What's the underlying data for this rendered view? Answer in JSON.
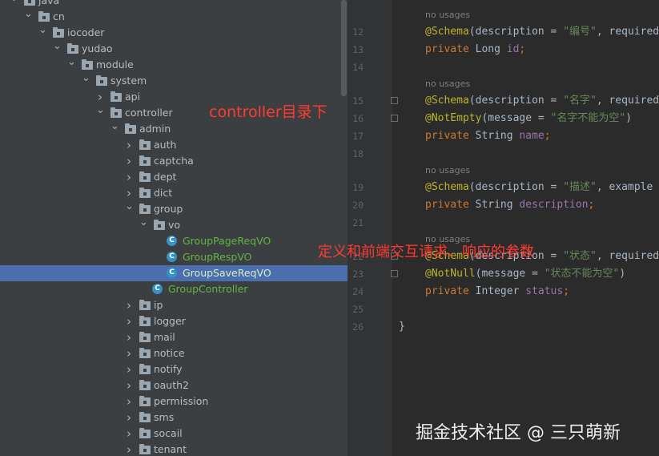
{
  "tree": {
    "rows": [
      {
        "label": "java",
        "type": "folder",
        "expanded": true,
        "depth": 0
      },
      {
        "label": "cn",
        "type": "folder",
        "expanded": true,
        "depth": 1
      },
      {
        "label": "iocoder",
        "type": "folder",
        "expanded": true,
        "depth": 2
      },
      {
        "label": "yudao",
        "type": "folder",
        "expanded": true,
        "depth": 3
      },
      {
        "label": "module",
        "type": "folder",
        "expanded": true,
        "depth": 4
      },
      {
        "label": "system",
        "type": "folder",
        "expanded": true,
        "depth": 5
      },
      {
        "label": "api",
        "type": "folder",
        "expanded": false,
        "depth": 6
      },
      {
        "label": "controller",
        "type": "folder",
        "expanded": true,
        "depth": 6
      },
      {
        "label": "admin",
        "type": "folder",
        "expanded": true,
        "depth": 7
      },
      {
        "label": "auth",
        "type": "folder",
        "expanded": false,
        "depth": 8
      },
      {
        "label": "captcha",
        "type": "folder",
        "expanded": false,
        "depth": 8
      },
      {
        "label": "dept",
        "type": "folder",
        "expanded": false,
        "depth": 8
      },
      {
        "label": "dict",
        "type": "folder",
        "expanded": false,
        "depth": 8
      },
      {
        "label": "group",
        "type": "folder",
        "expanded": true,
        "depth": 8
      },
      {
        "label": "vo",
        "type": "folder",
        "expanded": true,
        "depth": 9
      },
      {
        "label": "GroupPageReqVO",
        "type": "class",
        "depth": 10
      },
      {
        "label": "GroupRespVO",
        "type": "class",
        "depth": 10
      },
      {
        "label": "GroupSaveReqVO",
        "type": "class",
        "depth": 10,
        "selected": true
      },
      {
        "label": "GroupController",
        "type": "class",
        "depth": 9
      },
      {
        "label": "ip",
        "type": "folder",
        "expanded": false,
        "depth": 8
      },
      {
        "label": "logger",
        "type": "folder",
        "expanded": false,
        "depth": 8
      },
      {
        "label": "mail",
        "type": "folder",
        "expanded": false,
        "depth": 8
      },
      {
        "label": "notice",
        "type": "folder",
        "expanded": false,
        "depth": 8
      },
      {
        "label": "notify",
        "type": "folder",
        "expanded": false,
        "depth": 8
      },
      {
        "label": "oauth2",
        "type": "folder",
        "expanded": false,
        "depth": 8
      },
      {
        "label": "permission",
        "type": "folder",
        "expanded": false,
        "depth": 8
      },
      {
        "label": "sms",
        "type": "folder",
        "expanded": false,
        "depth": 8
      },
      {
        "label": "socail",
        "type": "folder",
        "expanded": false,
        "depth": 8
      },
      {
        "label": "tenant",
        "type": "folder",
        "expanded": false,
        "depth": 8
      }
    ]
  },
  "editor": {
    "lines": [
      {
        "n": "",
        "hint": "no usages"
      },
      {
        "n": "12",
        "tokens": [
          [
            "ann",
            "@Schema"
          ],
          [
            "punct",
            "(description = "
          ],
          [
            "str",
            "\"编号\""
          ],
          [
            "punct",
            ", required"
          ]
        ]
      },
      {
        "n": "13",
        "tokens": [
          [
            "kw",
            "private "
          ],
          [
            "punct",
            "Long "
          ],
          [
            "fld",
            "id"
          ],
          [
            "kw",
            ";"
          ]
        ]
      },
      {
        "n": "14",
        "tokens": []
      },
      {
        "n": "",
        "hint": "no usages"
      },
      {
        "n": "15",
        "fold": true,
        "tokens": [
          [
            "ann",
            "@Schema"
          ],
          [
            "punct",
            "(description = "
          ],
          [
            "str",
            "\"名字\""
          ],
          [
            "punct",
            ", required"
          ]
        ]
      },
      {
        "n": "16",
        "fold": true,
        "tokens": [
          [
            "ann",
            "@NotEmpty"
          ],
          [
            "punct",
            "(message = "
          ],
          [
            "str",
            "\"名字不能为空\""
          ],
          [
            "punct",
            ")"
          ]
        ]
      },
      {
        "n": "17",
        "tokens": [
          [
            "kw",
            "private "
          ],
          [
            "punct",
            "String "
          ],
          [
            "fld",
            "name"
          ],
          [
            "kw",
            ";"
          ]
        ]
      },
      {
        "n": "18",
        "tokens": []
      },
      {
        "n": "",
        "hint": "no usages"
      },
      {
        "n": "19",
        "tokens": [
          [
            "ann",
            "@Schema"
          ],
          [
            "punct",
            "(description = "
          ],
          [
            "str",
            "\"描述\""
          ],
          [
            "punct",
            ", example"
          ]
        ]
      },
      {
        "n": "20",
        "tokens": [
          [
            "kw",
            "private "
          ],
          [
            "punct",
            "String "
          ],
          [
            "fld",
            "description"
          ],
          [
            "kw",
            ";"
          ]
        ]
      },
      {
        "n": "21",
        "tokens": []
      },
      {
        "n": "",
        "hint": "no usages"
      },
      {
        "n": "22",
        "fold": true,
        "tokens": [
          [
            "ann",
            "@Schema"
          ],
          [
            "punct",
            "(description = "
          ],
          [
            "str",
            "\"状态\""
          ],
          [
            "punct",
            ", required"
          ]
        ]
      },
      {
        "n": "23",
        "fold": true,
        "tokens": [
          [
            "ann",
            "@NotNull"
          ],
          [
            "punct",
            "(message = "
          ],
          [
            "str",
            "\"状态不能为空\""
          ],
          [
            "punct",
            ")"
          ]
        ]
      },
      {
        "n": "24",
        "tokens": [
          [
            "kw",
            "private "
          ],
          [
            "punct",
            "Integer "
          ],
          [
            "fld",
            "status"
          ],
          [
            "kw",
            ";"
          ]
        ]
      },
      {
        "n": "25",
        "tokens": []
      },
      {
        "n": "26",
        "tokens": [
          [
            "punct",
            "}"
          ]
        ],
        "indent": 0
      }
    ]
  },
  "annotations": {
    "controller_note": "controller目录下",
    "vo_note": "定义和前端交互请求、响应的参数"
  },
  "watermark": "掘金技术社区 @ 三只萌新",
  "colors": {
    "annotation": "#bbb529",
    "keyword": "#cc7832",
    "string": "#6a8759",
    "field": "#9876aa",
    "selection": "#4b6eaf",
    "note": "#ff3b30"
  }
}
